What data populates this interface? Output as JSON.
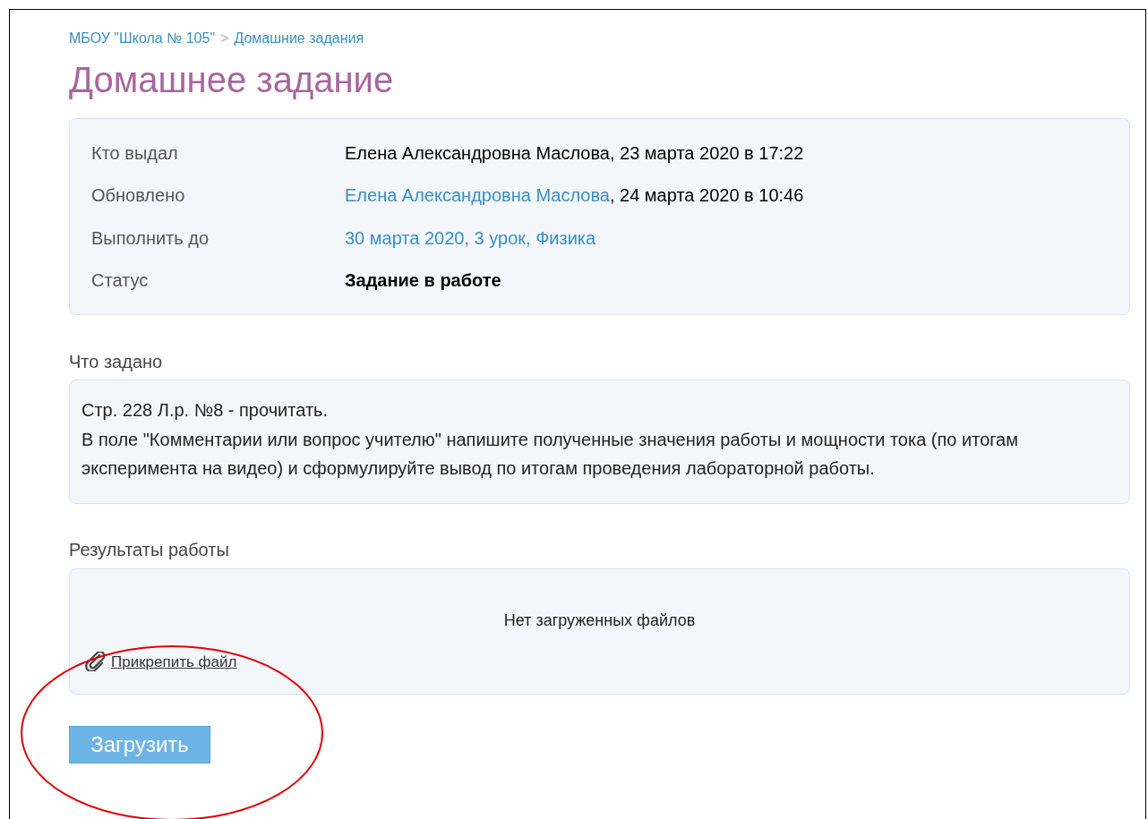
{
  "breadcrumb": [
    {
      "label": "МБОУ \"Школа № 105\""
    },
    {
      "label": "Домашние задания"
    }
  ],
  "breadcrumb_separator": ">",
  "title": "Домашнее задание",
  "details": [
    {
      "label": "Кто выдал",
      "parts": [
        {
          "kind": "text",
          "text": "Елена Александровна Маслова, 23 марта 2020 в 17:22"
        }
      ]
    },
    {
      "label": "Обновлено",
      "parts": [
        {
          "kind": "link",
          "text": "Елена Александровна Маслова"
        },
        {
          "kind": "text",
          "text": " , 24 марта 2020 в 10:46"
        }
      ]
    },
    {
      "label": "Выполнить до",
      "parts": [
        {
          "kind": "link",
          "text": "30 марта 2020, 3 урок, Физика"
        }
      ]
    },
    {
      "label": "Статус",
      "parts": [
        {
          "kind": "bold",
          "text": "Задание в работе"
        }
      ]
    }
  ],
  "task": {
    "heading": "Что задано",
    "paragraphs": [
      "Стр. 228 Л.р. №8 - прочитать.",
      "В поле \"Комментарии или вопрос учителю\" напишите полученные значения работы и мощности тока (по итогам эксперимента на видео) и сформулируйте вывод по итогам проведения лабораторной работы."
    ]
  },
  "results": {
    "heading": "Результаты работы",
    "empty_text": "Нет загруженных файлов",
    "attach_link": "Прикрепить файл",
    "upload_button": "Загрузить"
  },
  "annotation": {
    "color": "#e00000"
  }
}
